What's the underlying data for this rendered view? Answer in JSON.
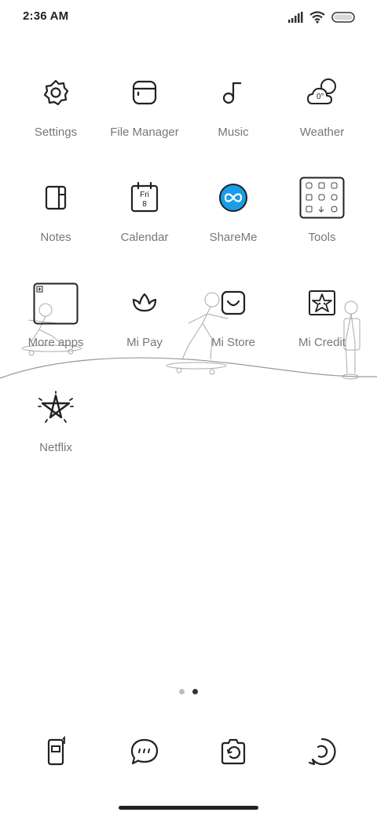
{
  "status_bar": {
    "time": "2:36 AM"
  },
  "apps": [
    {
      "label": "Settings",
      "icon": "gear-icon"
    },
    {
      "label": "File Manager",
      "icon": "folder-icon"
    },
    {
      "label": "Music",
      "icon": "music-note-icon"
    },
    {
      "label": "Weather",
      "icon": "weather-icon",
      "icon_text": "0°"
    },
    {
      "label": "Notes",
      "icon": "notes-icon"
    },
    {
      "label": "Calendar",
      "icon": "calendar-icon",
      "icon_text_day": "Fri",
      "icon_text_date": "8"
    },
    {
      "label": "ShareMe",
      "icon": "shareme-icon"
    },
    {
      "label": "Tools",
      "icon": "tools-folder-icon"
    },
    {
      "label": "More apps",
      "icon": "more-apps-icon"
    },
    {
      "label": "Mi Pay",
      "icon": "lotus-icon"
    },
    {
      "label": "Mi Store",
      "icon": "store-bag-icon"
    },
    {
      "label": "Mi Credit",
      "icon": "star-badge-icon"
    },
    {
      "label": "Netflix",
      "icon": "netflix-star-icon"
    }
  ],
  "pager": {
    "pages": 2,
    "active_page": 2
  },
  "dock": [
    {
      "icon": "phone-icon"
    },
    {
      "icon": "messages-icon"
    },
    {
      "icon": "camera-icon"
    },
    {
      "icon": "browser-icon"
    }
  ],
  "colors": {
    "shareme_accent": "#1a9de8",
    "label_gray": "#777777",
    "icon_stroke": "#222222"
  }
}
